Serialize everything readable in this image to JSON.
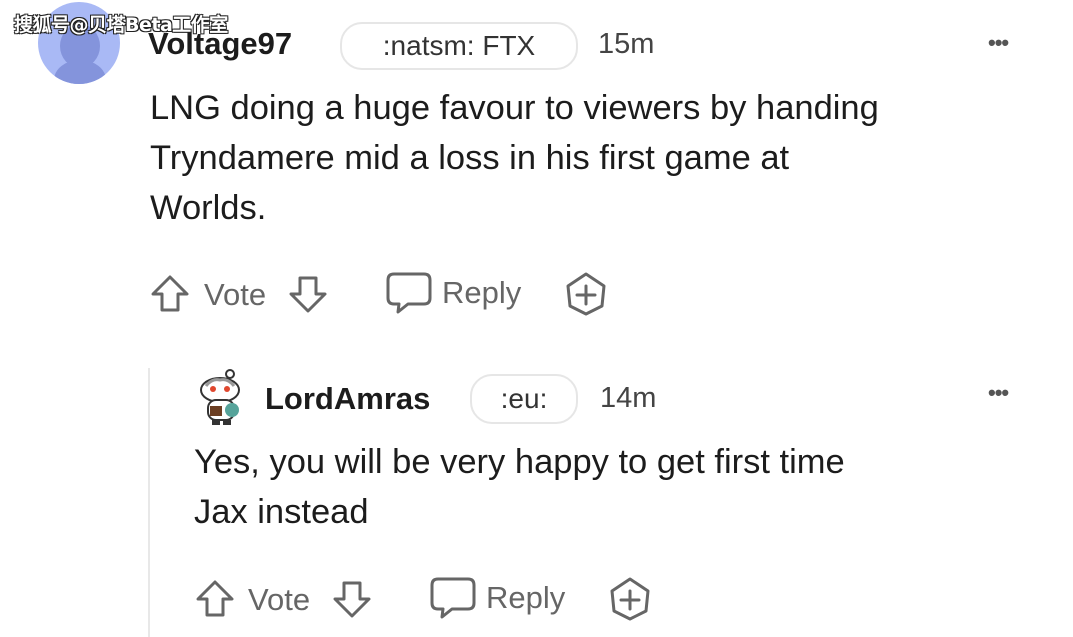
{
  "watermark": "搜狐号@贝塔Beta工作室",
  "comments": [
    {
      "username": "Voltage97",
      "flair": ":natsm: FTX",
      "time": "15m",
      "text_lines": [
        "LNG doing a huge favour to viewers by handing",
        "Tryndamere mid a loss in his first game at",
        "Worlds."
      ],
      "vote_label": "Vote",
      "reply_label": "Reply",
      "more_label": "•••"
    },
    {
      "username": "LordAmras",
      "flair": ":eu:",
      "time": "14m",
      "text_lines": [
        "Yes, you will be very happy to get first time",
        "Jax instead"
      ],
      "vote_label": "Vote",
      "reply_label": "Reply",
      "more_label": "•••"
    }
  ],
  "icons": {
    "upvote": "arrow-up-icon",
    "downvote": "arrow-down-icon",
    "reply": "speech-bubble-icon",
    "award": "add-award-icon",
    "more": "more-options-icon"
  },
  "colors": {
    "avatar_bg": "#a9b9f5",
    "avatar_fg": "#8494dc",
    "text": "#1c1c1c",
    "muted": "#666666"
  }
}
